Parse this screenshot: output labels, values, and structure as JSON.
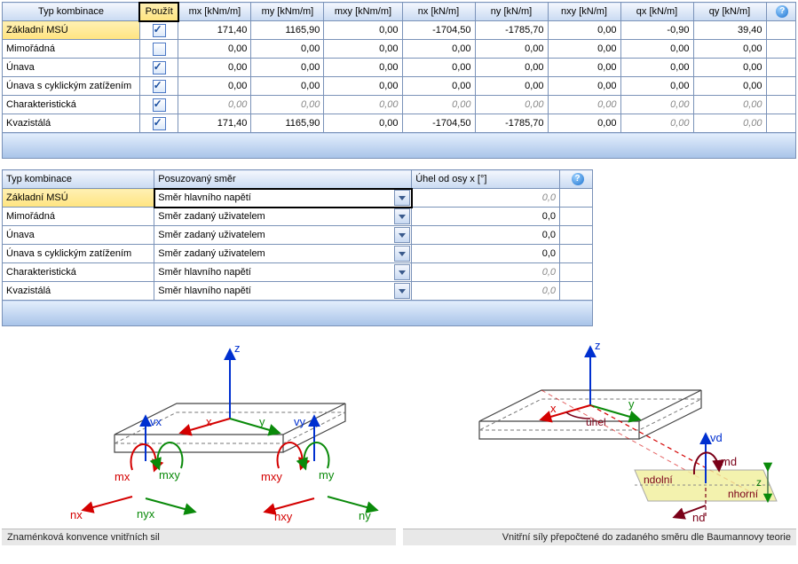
{
  "t1": {
    "headers": {
      "type": "Typ kombinace",
      "use": "Použít",
      "mx": "mx [kNm/m]",
      "my": "my [kNm/m]",
      "mxy": "mxy [kNm/m]",
      "nx": "nx [kN/m]",
      "ny": "ny [kN/m]",
      "nxy": "nxy [kN/m]",
      "qx": "qx [kN/m]",
      "qy": "qy [kN/m]"
    },
    "rows": [
      {
        "name": "Základní MSÚ",
        "use": true,
        "sel": true,
        "mx": "171,40",
        "my": "1165,90",
        "mxy": "0,00",
        "nx": "-1704,50",
        "ny": "-1785,70",
        "nxy": "0,00",
        "qx": "-0,90",
        "qy": "39,40"
      },
      {
        "name": "Mimořádná",
        "use": false,
        "mx": "0,00",
        "my": "0,00",
        "mxy": "0,00",
        "nx": "0,00",
        "ny": "0,00",
        "nxy": "0,00",
        "qx": "0,00",
        "qy": "0,00"
      },
      {
        "name": "Únava",
        "use": true,
        "mx": "0,00",
        "my": "0,00",
        "mxy": "0,00",
        "nx": "0,00",
        "ny": "0,00",
        "nxy": "0,00",
        "qx": "0,00",
        "qy": "0,00"
      },
      {
        "name": "Únava s cyklickým zatížením",
        "use": true,
        "mx": "0,00",
        "my": "0,00",
        "mxy": "0,00",
        "nx": "0,00",
        "ny": "0,00",
        "nxy": "0,00",
        "qx": "0,00",
        "qy": "0,00"
      },
      {
        "name": "Charakteristická",
        "use": true,
        "dim": true,
        "mx": "0,00",
        "my": "0,00",
        "mxy": "0,00",
        "nx": "0,00",
        "ny": "0,00",
        "nxy": "0,00",
        "qx": "0,00",
        "qy": "0,00"
      },
      {
        "name": "Kvazistálá",
        "use": true,
        "mx": "171,40",
        "my": "1165,90",
        "mxy": "0,00",
        "nx": "-1704,50",
        "ny": "-1785,70",
        "nxy": "0,00",
        "qx": "0,00",
        "qy": "0,00",
        "dimlast2": true
      }
    ]
  },
  "t2": {
    "headers": {
      "type": "Typ kombinace",
      "dir": "Posuzovaný směr",
      "ang": "Úhel od osy x [°]"
    },
    "rows": [
      {
        "name": "Základní MSÚ",
        "dir": "Směr hlavního napětí",
        "ang": "0,0",
        "dim": true,
        "sel": true
      },
      {
        "name": "Mimořádná",
        "dir": "Směr zadaný uživatelem",
        "ang": "0,0"
      },
      {
        "name": "Únava",
        "dir": "Směr zadaný uživatelem",
        "ang": "0,0"
      },
      {
        "name": "Únava s cyklickým zatížením",
        "dir": "Směr zadaný uživatelem",
        "ang": "0,0"
      },
      {
        "name": "Charakteristická",
        "dir": "Směr hlavního napětí",
        "ang": "0,0",
        "dim": true
      },
      {
        "name": "Kvazistálá",
        "dir": "Směr hlavního napětí",
        "ang": "0,0",
        "dim": true
      }
    ]
  },
  "captions": {
    "left": "Znaménková konvence vnitřních sil",
    "right": "Vnitřní síly přepočtené do zadaného směru dle Baumannovy teorie"
  },
  "labels": {
    "z": "z",
    "x": "x",
    "y": "y",
    "vx": "vx",
    "vy": "vy",
    "mx": "mx",
    "mxy": "mxy",
    "my": "my",
    "nx": "nx",
    "nyx": "nyx",
    "nxy": "nxy",
    "ny": "ny",
    "uhel": "úhel",
    "vd": "vd",
    "md": "md",
    "ndolni": "ndolní",
    "nhorni": "nhorní",
    "nd": "nd",
    "zsmall": "z"
  }
}
